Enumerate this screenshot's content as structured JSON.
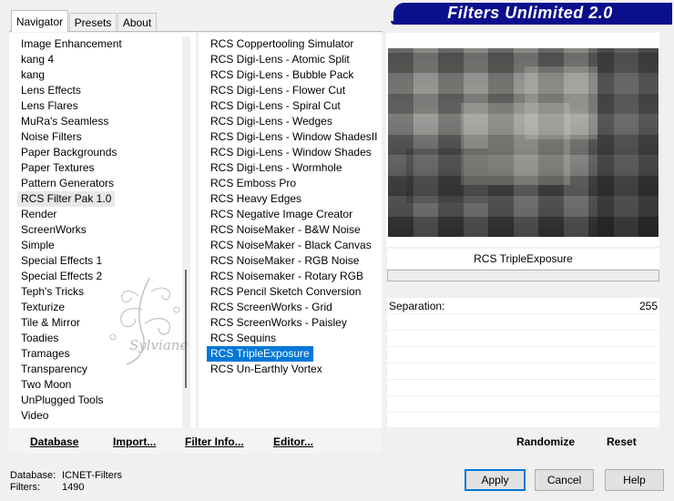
{
  "tabs": [
    "Navigator",
    "Presets",
    "About"
  ],
  "banner_title": "Filters Unlimited 2.0",
  "categories": [
    "Image Enhancement",
    "kang 4",
    "kang",
    "Lens Effects",
    "Lens Flares",
    "MuRa's Seamless",
    "Noise Filters",
    "Paper Backgrounds",
    "Paper Textures",
    "Pattern Generators",
    "RCS Filter Pak 1.0",
    "Render",
    "ScreenWorks",
    "Simple",
    "Special Effects 1",
    "Special Effects 2",
    "Teph's Tricks",
    "Texturize",
    "Tile & Mirror",
    "Toadies",
    "Tramages",
    "Transparency",
    "Two Moon",
    "UnPlugged Tools",
    "Video"
  ],
  "selected_category": "RCS Filter Pak 1.0",
  "filters": [
    "RCS Coppertooling Simulator",
    "RCS Digi-Lens - Atomic Split",
    "RCS Digi-Lens - Bubble Pack",
    "RCS Digi-Lens - Flower Cut",
    "RCS Digi-Lens - Spiral Cut",
    "RCS Digi-Lens - Wedges",
    "RCS Digi-Lens - Window ShadesII",
    "RCS Digi-Lens - Window Shades",
    "RCS Digi-Lens - Wormhole",
    "RCS Emboss Pro",
    "RCS Heavy Edges",
    "RCS Negative Image Creator",
    "RCS NoiseMaker - B&W Noise",
    "RCS NoiseMaker - Black Canvas",
    "RCS NoiseMaker - RGB Noise",
    "RCS Noisemaker - Rotary RGB",
    "RCS Pencil Sketch Conversion",
    "RCS ScreenWorks - Grid",
    "RCS ScreenWorks - Paisley",
    "RCS Sequins",
    "RCS TripleExposure",
    "RCS Un-Earthly Vortex"
  ],
  "selected_filter": "RCS TripleExposure",
  "database_buttons": {
    "database": "Database",
    "import": "Import...",
    "filter_info": "Filter Info...",
    "editor": "Editor..."
  },
  "current_filter_name": "RCS TripleExposure",
  "parameters": [
    {
      "label": "Separation:",
      "value": "255"
    }
  ],
  "randomize_label": "Randomize",
  "reset_label": "Reset",
  "status": {
    "database_label": "Database:",
    "database_value": "ICNET-Filters",
    "filters_label": "Filters:",
    "filters_value": "1490"
  },
  "buttons": {
    "apply": "Apply",
    "cancel": "Cancel",
    "help": "Help"
  },
  "watermark_text": "Sylviane",
  "colors": {
    "banner": "#0b0f8c",
    "selection": "#0078d7",
    "apply_border": "#0078d7"
  }
}
